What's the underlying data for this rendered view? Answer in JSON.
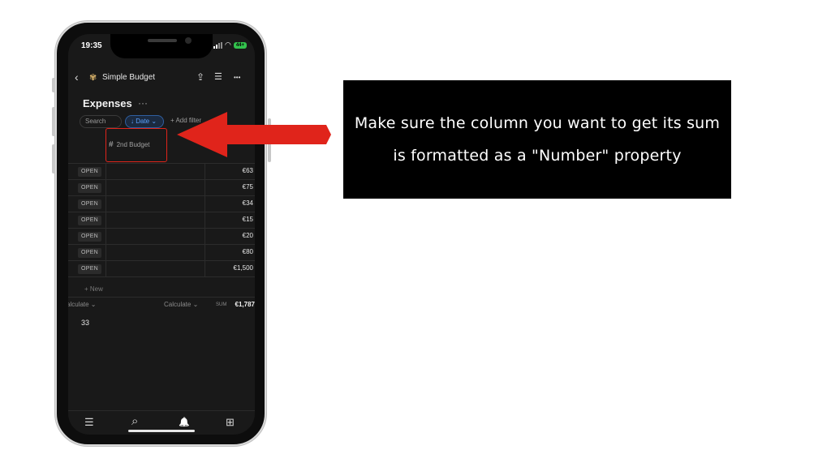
{
  "status": {
    "time": "19:35",
    "battery": "44+"
  },
  "topbar": {
    "page_name": "Simple Budget",
    "page_emoji": "✾",
    "back": "‹",
    "share": "⇪",
    "comments": "☰",
    "more": "•••"
  },
  "db": {
    "title": "Expenses",
    "title_more": "···",
    "search": "Search",
    "date_filter": "↓ Date ⌄",
    "add_filter": "+ Add filter",
    "column": {
      "hash": "#",
      "name": "2nd Budget"
    },
    "open_label": "OPEN",
    "rows": [
      "€63",
      "€75",
      "€34",
      "€15",
      "€20",
      "€80",
      "€1,500"
    ],
    "new_label": "+ New",
    "calc_left": "alculate ⌄",
    "calc_mid": "Calculate ⌄",
    "sum_label": "SUM",
    "sum_value": "€1,787",
    "count": "33"
  },
  "nav": {
    "list": "☰",
    "search": "⌕",
    "bell": "🔔",
    "add": "⊞"
  },
  "caption": {
    "line1": "Make sure the column you want to get its sum",
    "line2": "is formatted as a \"Number\" property"
  },
  "colors": {
    "annotation_red": "#e0241b",
    "caption_bg": "#000000",
    "date_chip": "#5ea3ff"
  }
}
